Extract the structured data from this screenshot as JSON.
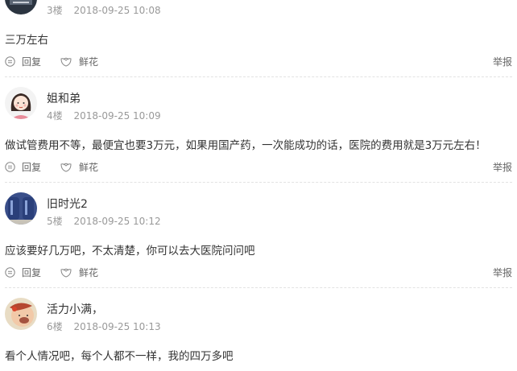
{
  "posts": [
    {
      "floor": "3楼",
      "time": "2018-09-25 10:08",
      "content": "三万左右",
      "reply_label": "回复",
      "flower_label": "鲜花",
      "report_label": "举报"
    },
    {
      "username": "姐和弟",
      "floor": "4楼",
      "time": "2018-09-25 10:09",
      "content": "做试管费用不等，最便宜也要3万元，如果用国产药，一次能成功的话，医院的费用就是3万元左右！",
      "reply_label": "回复",
      "flower_label": "鲜花",
      "report_label": "举报"
    },
    {
      "username": "旧时光2",
      "floor": "5楼",
      "time": "2018-09-25 10:12",
      "content": "应该要好几万吧，不太清楚，你可以去大医院问问吧",
      "reply_label": "回复",
      "flower_label": "鲜花",
      "report_label": "举报"
    },
    {
      "username": "活力小满，",
      "floor": "6楼",
      "time": "2018-09-25 10:13",
      "content": "看个人情况吧，每个人都不一样，我的四万多吧"
    }
  ],
  "icons": {
    "reply": "reply-icon",
    "flower": "flower-icon",
    "avatar_fallback": "user-avatar"
  },
  "colors": {
    "text": "#333333",
    "meta": "#999999",
    "action": "#666666",
    "divider": "#e2e2e2"
  }
}
